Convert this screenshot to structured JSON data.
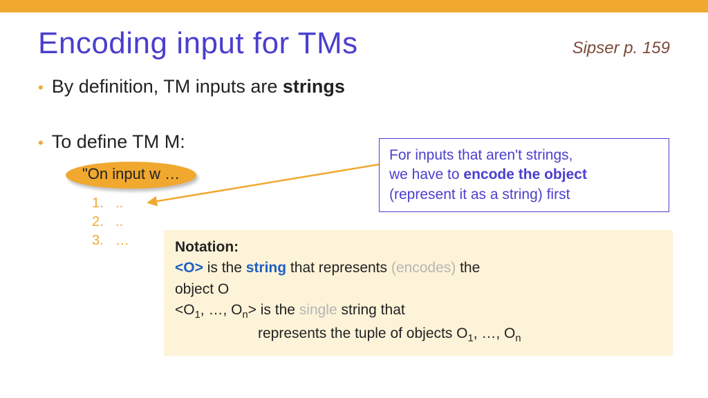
{
  "colors": {
    "accent": "#f0a82e",
    "heading": "#4a3fce",
    "link": "#1f5fbf"
  },
  "title": "Encoding input for TMs",
  "page_ref": "Sipser p. 159",
  "bullet1_pre": "By definition, TM inputs are ",
  "bullet1_strong": "strings",
  "bullet2": "To define TM M:",
  "oval_text": "\"On input w …",
  "steps": [
    {
      "num": "1.",
      "dots": ".."
    },
    {
      "num": "2.",
      "dots": ".."
    },
    {
      "num": "3.",
      "dots": "…"
    }
  ],
  "callout": {
    "line1": "For inputs that aren't strings,",
    "line2_pre": "we have to ",
    "line2_strong": "encode the object",
    "line3": "(represent it as a string) first"
  },
  "notation": {
    "head": "Notation:",
    "l1_a": "<O>",
    "l1_b": " is the ",
    "l1_c": "string",
    "l1_d": " that represents ",
    "l1_e": "(encodes)",
    "l1_f": "   the",
    "l1_g": "object O",
    "l2_a": "<O",
    "l2_s1": "1",
    "l2_b": ", …, O",
    "l2_s2": "n",
    "l2_c": "> is the ",
    "l2_d": "single",
    "l2_e": " string that",
    "l3_a": "represents the tuple of objects O",
    "l3_s1": "1",
    "l3_b": ", …, O",
    "l3_s2": "n"
  }
}
